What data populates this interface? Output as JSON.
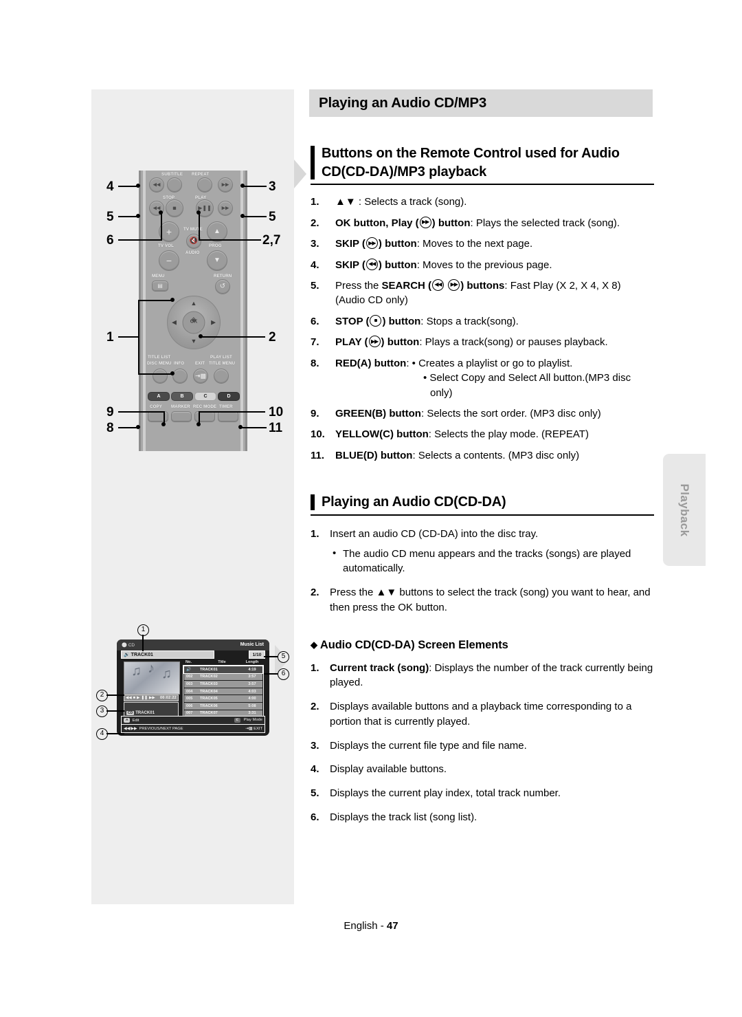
{
  "page": {
    "title": "Playing an Audio CD/MP3",
    "footer_label": "English -",
    "footer_page": "47",
    "side_tab": "Playback"
  },
  "section1": {
    "heading_line1": "Buttons on the Remote Control used for Audio",
    "heading_line2": "CD(CD-DA)/MP3 playback",
    "items": [
      {
        "num": "1.",
        "pre": "",
        "bold": "",
        "text_prefix": "▲▼ : Selects a track (song)."
      },
      {
        "num": "2.",
        "bold": "OK button, Play (",
        "icon": "play-icon",
        "bold_tail": ") button",
        "text": ": Plays the selected track (song)."
      },
      {
        "num": "3.",
        "bold": "SKIP (",
        "icon": "skip-next-icon",
        "bold_tail": ") button",
        "text": ": Moves to the next page."
      },
      {
        "num": "4.",
        "bold": "SKIP (",
        "icon": "skip-prev-icon",
        "bold_tail": ") button",
        "text": ": Moves to the previous page."
      },
      {
        "num": "5.",
        "lead": "Press the ",
        "bold": "SEARCH (",
        "icon": "search-rew-icon",
        "icon2": "search-ff-icon",
        "bold_tail": ") buttons",
        "text": ": Fast Play (X 2, X 4, X 8)",
        "text2": "(Audio CD only)"
      },
      {
        "num": "6.",
        "bold": "STOP (",
        "icon": "stop-icon",
        "bold_tail": ") button",
        "text": ": Stops a track(song)."
      },
      {
        "num": "7.",
        "bold": "PLAY (",
        "icon": "play-icon",
        "bold_tail": ") button",
        "text": ": Plays a track(song) or pauses playback."
      },
      {
        "num": "8.",
        "bold": "RED(A) button",
        "text": ": • Creates a playlist or go to playlist.",
        "text2": "• Select Copy and Select All button.(MP3 disc only)"
      },
      {
        "num": "9.",
        "bold": "GREEN(B) button",
        "text": ": Selects the sort order. (MP3 disc only)"
      },
      {
        "num": "10.",
        "bold": "YELLOW(C) button",
        "text": ": Selects the play mode. (REPEAT)"
      },
      {
        "num": "11.",
        "bold": "BLUE(D) button",
        "text": ": Selects a contents. (MP3 disc only)"
      }
    ]
  },
  "section2": {
    "heading": "Playing an Audio CD(CD-DA)",
    "steps": [
      {
        "num": "1.",
        "text": "Insert an audio CD (CD-DA) into the disc tray.",
        "bullet": "The audio CD menu appears and the tracks (songs) are played automatically."
      },
      {
        "num": "2.",
        "text": "Press the ▲▼ buttons to select the track (song) you want to hear, and then press the OK button."
      }
    ]
  },
  "section3": {
    "heading": "Audio CD(CD-DA) Screen Elements",
    "items": [
      {
        "num": "1.",
        "bold": "Current track (song)",
        "text": ": Displays the number of the track currently being played."
      },
      {
        "num": "2.",
        "bold": "",
        "text": "Displays available buttons and a playback time corresponding to a portion that is currently played."
      },
      {
        "num": "3.",
        "bold": "",
        "text": "Displays the current file type and file name."
      },
      {
        "num": "4.",
        "bold": "",
        "text": "Display available buttons."
      },
      {
        "num": "5.",
        "bold": "",
        "text": "Displays the current play index, total track number."
      },
      {
        "num": "6.",
        "bold": "",
        "text": "Displays the track list (song list)."
      }
    ]
  },
  "remote": {
    "labels": {
      "subtitle": "SUBTITLE",
      "repeat": "REPEAT",
      "stop": "STOP",
      "play": "PLAY",
      "tv_vol": "TV VOL",
      "tv_mute": "TV MUTE",
      "audio": "AUDIO",
      "prog": "PROG",
      "menu": "MENU",
      "return": "RETURN",
      "title_list": "TITLE LIST",
      "disc_menu": "DISC MENU",
      "info": "INFO",
      "exit": "EXIT",
      "play_list": "PLAY LIST",
      "title_menu": "TITLE MENU",
      "copy": "COPY",
      "marker": "MARKER",
      "rec_mode": "REC MODE",
      "timer": "TIMER",
      "ok": "OK"
    },
    "color_buttons": [
      {
        "label": "A",
        "color": "#4a4a4a"
      },
      {
        "label": "B",
        "color": "#5a5a5a"
      },
      {
        "label": "C",
        "color": "#d4d4d4"
      },
      {
        "label": "D",
        "color": "#3d3d3d"
      }
    ],
    "callouts": [
      "4",
      "3",
      "5",
      "5",
      "6",
      "2,7",
      "1",
      "2",
      "9",
      "10",
      "8",
      "11"
    ]
  },
  "tv_screen": {
    "disc_label": "CD",
    "menu_title": "Music List",
    "current_track": "TRACK01",
    "play_index": "1/10",
    "columns": {
      "no": "No.",
      "title": "Title",
      "length": "Length"
    },
    "tracks": [
      {
        "no": "",
        "title": "TRACK01",
        "length": "4:19",
        "selected": true
      },
      {
        "no": "002",
        "title": "TRACK02",
        "length": "3:57",
        "selected": false
      },
      {
        "no": "003",
        "title": "TRACK03",
        "length": "3:57",
        "selected": false
      },
      {
        "no": "004",
        "title": "TRACK04",
        "length": "4:03",
        "selected": false
      },
      {
        "no": "005",
        "title": "TRACK05",
        "length": "4:00",
        "selected": false
      },
      {
        "no": "006",
        "title": "TRACK06",
        "length": "5:08",
        "selected": false
      },
      {
        "no": "007",
        "title": "TRACK07",
        "length": "3:31",
        "selected": false
      }
    ],
    "elapsed": "00:02:22",
    "file_tag": "CD",
    "file_name": "TRACK01",
    "bottom": {
      "edit_chip": "A",
      "edit_label": "Edit",
      "playmode_chip": "C",
      "playmode_label": "Play Mode",
      "page_label": "PREVIOUS/NEXT PAGE",
      "exit_label": "EXIT"
    },
    "callouts": [
      "1",
      "2",
      "3",
      "4",
      "5",
      "6"
    ]
  }
}
